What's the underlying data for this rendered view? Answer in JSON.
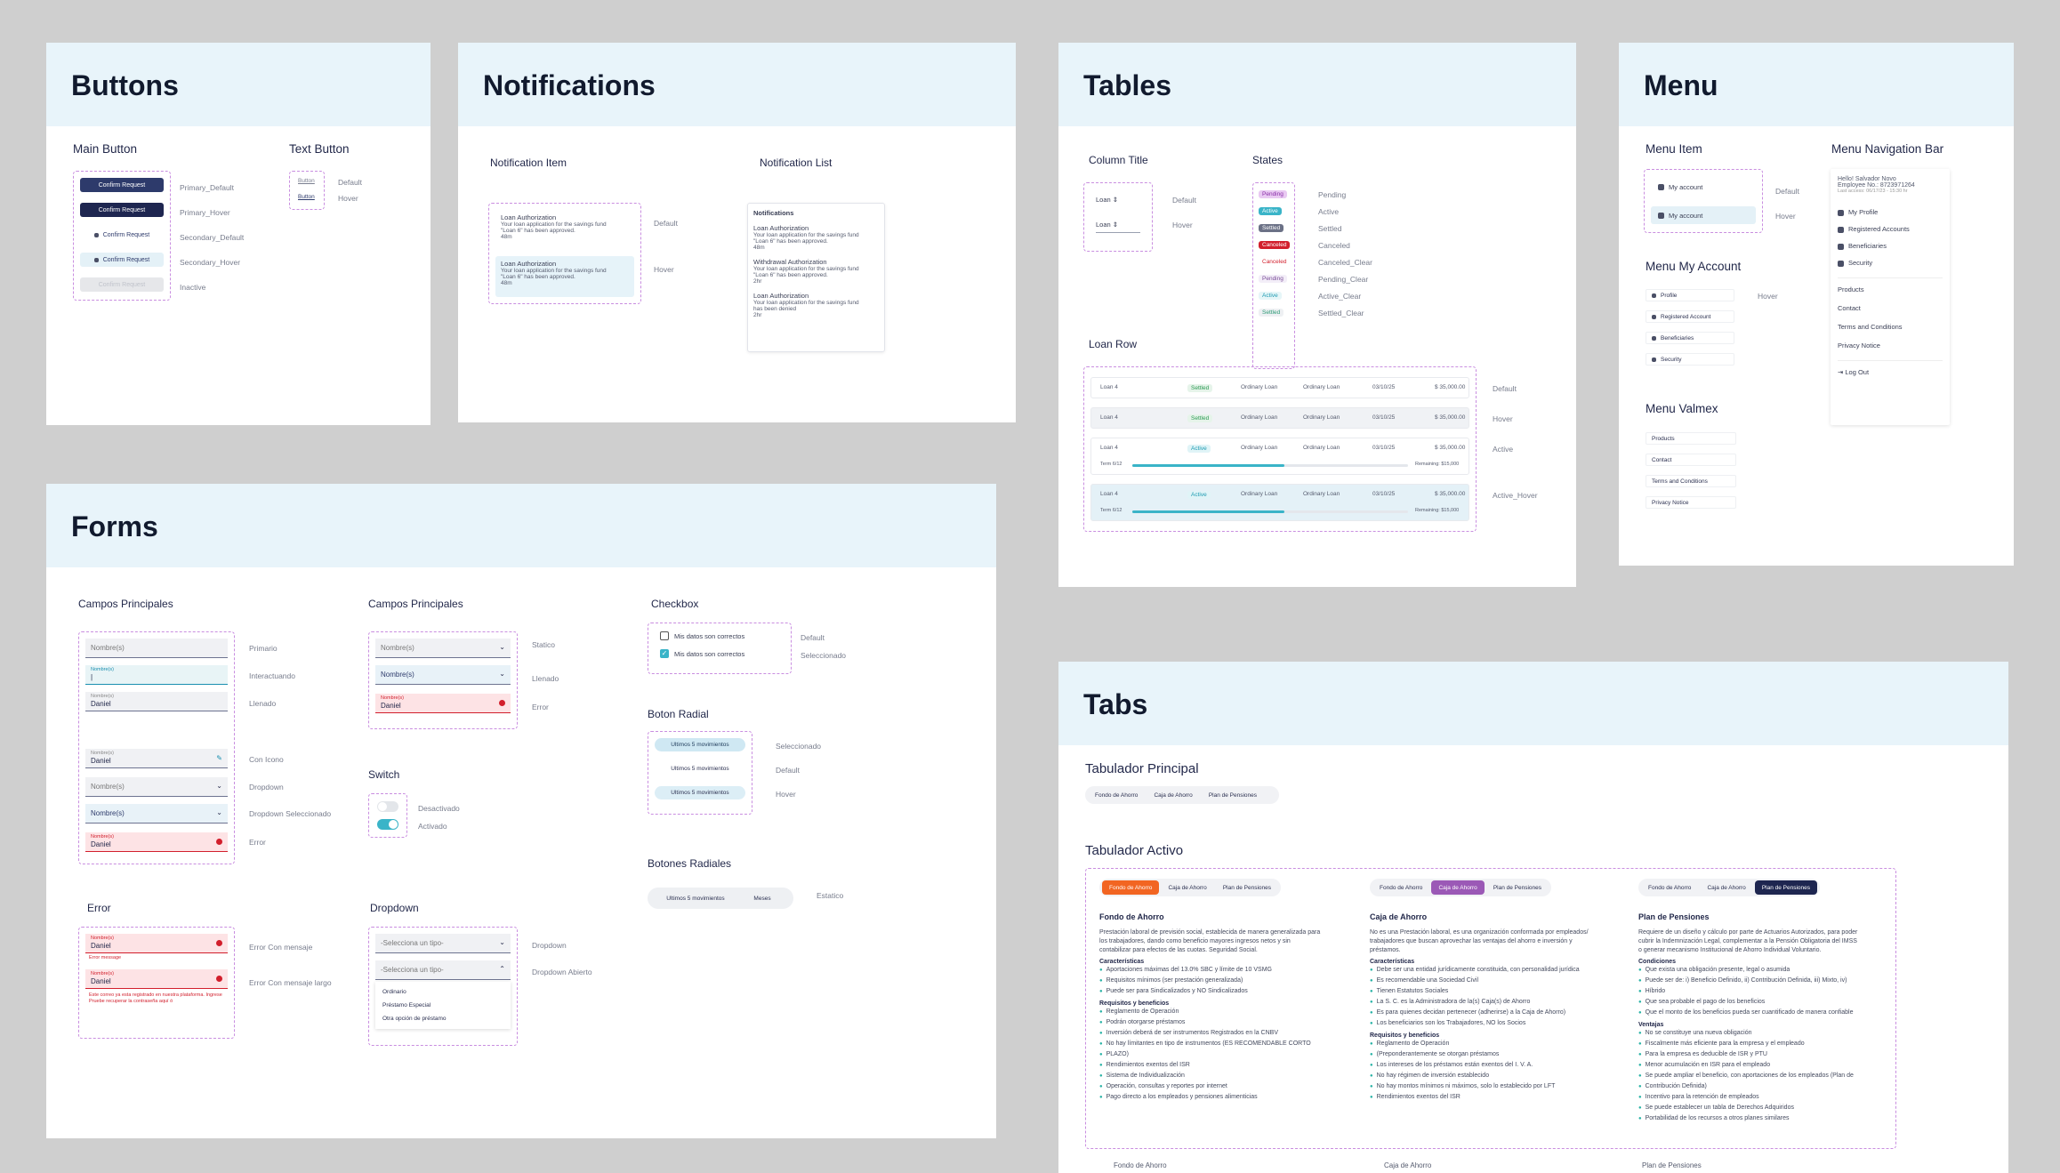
{
  "buttons": {
    "title": "Buttons",
    "main_title": "Main Button",
    "text_title": "Text Button",
    "btn_label": "Confirm Request",
    "states": [
      "Primary_Default",
      "Primary_Hover",
      "Secondary_Default",
      "Secondary_Hover",
      "Inactive"
    ],
    "text_btn": "Button",
    "text_states": [
      "Default",
      "Hover"
    ]
  },
  "notifications": {
    "title": "Notifications",
    "item_title": "Notification Item",
    "list_title": "Notification List",
    "item_head": "Loan Authorization",
    "item_body1": "Your loan application for the savings fund",
    "item_body2": "\"Loan 6\" has been approved.",
    "item_time": "48m",
    "states": [
      "Default",
      "Hover"
    ],
    "list_label": "Notifications",
    "list": [
      {
        "h": "Loan Authorization",
        "b1": "Your loan application for the savings fund",
        "b2": "\"Loan 6\" has been approved.",
        "t": "48m"
      },
      {
        "h": "Withdrawal Authorization",
        "b1": "Your loan application for the savings fund",
        "b2": "\"Loan 6\" has been approved.",
        "t": "2hr"
      },
      {
        "h": "Loan Authorization",
        "b1": "Your loan application for the savings fund",
        "b2": "has been denied",
        "t": "2hr"
      }
    ]
  },
  "tables": {
    "title": "Tables",
    "col_title": "Column Title",
    "states_title": "States",
    "loan_row_title": "Loan Row",
    "col_head": "Loan",
    "col_states": [
      "Default",
      "Hover"
    ],
    "badges": [
      {
        "t": "Pending",
        "l": "Pending"
      },
      {
        "t": "Active",
        "l": "Active"
      },
      {
        "t": "Settled",
        "l": "Settled"
      },
      {
        "t": "Canceled",
        "l": "Canceled"
      },
      {
        "t": "Canceled",
        "l": "Canceled_Clear"
      },
      {
        "t": "Pending",
        "l": "Pending_Clear"
      },
      {
        "t": "Active",
        "l": "Active_Clear"
      },
      {
        "t": "Settled",
        "l": "Settled_Clear"
      }
    ],
    "rows": [
      {
        "n": "Loan 4",
        "s": "Settled",
        "c1": "Ordinary Loan",
        "c2": "Ordinary Loan",
        "d": "03/10/25",
        "a": "$ 35,000.00",
        "st": "Default"
      },
      {
        "n": "Loan 4",
        "s": "Settled",
        "c1": "Ordinary Loan",
        "c2": "Ordinary Loan",
        "d": "03/10/25",
        "a": "$ 35,000.00",
        "st": "Hover"
      },
      {
        "n": "Loan 4",
        "s": "Active",
        "c1": "Ordinary Loan",
        "c2": "Ordinary Loan",
        "d": "03/10/25",
        "a": "$ 35,000.00",
        "st": "Active",
        "term": "Term 6/12",
        "rem": "Remaining: $15,000",
        "p": 0.55
      },
      {
        "n": "Loan 4",
        "s": "Active",
        "c1": "Ordinary Loan",
        "c2": "Ordinary Loan",
        "d": "03/10/25",
        "a": "$ 35,000.00",
        "st": "Active_Hover",
        "term": "Term 6/12",
        "rem": "Remaining: $15,000",
        "p": 0.55
      }
    ]
  },
  "menu": {
    "title": "Menu",
    "item_title": "Menu Item",
    "navbar_title": "Menu Navigation Bar",
    "my_account": "My account",
    "item_states": [
      "Default",
      "Hover"
    ],
    "myacc_title": "Menu My Account",
    "myacc_items": [
      "Profile",
      "Registered Account",
      "Beneficiaries",
      "Security"
    ],
    "myacc_state": "Hover",
    "valmex_title": "Menu Valmex",
    "valmex_items": [
      "Products",
      "Contact",
      "Terms and Conditions",
      "Privacy Notice"
    ],
    "nav": {
      "hello": "Hello! Salvador Novo",
      "emp": "Employee No.: 8723971264",
      "last": "Last access: 06/17/23 - 15:30 hr",
      "items": [
        "My Profile",
        "Registered Accounts",
        "Beneficiaries",
        "Security"
      ],
      "links": [
        "Products",
        "Contact",
        "Terms and Conditions",
        "Privacy Notice"
      ],
      "logout": "Log Out"
    }
  },
  "forms": {
    "title": "Forms",
    "cp_title": "Campos Principales",
    "cp2_title": "Campos Principales",
    "cb_title": "Checkbox",
    "radio_title": "Boton Radial",
    "radios_title": "Botones Radiales",
    "switch_title": "Switch",
    "error_title": "Error",
    "dropdown_title": "Dropdown",
    "field_label": "Nombre(s)",
    "field_value": "Daniel",
    "cp_states": [
      "Primario",
      "Interactuando",
      "Llenado",
      "Con Icono",
      "Dropdown",
      "Dropdown Seleccionado",
      "Error"
    ],
    "cp2_states": [
      "Statico",
      "Llenado",
      "Error"
    ],
    "cb_label": "Mis datos son correctos",
    "cb_states": [
      "Default",
      "Seleccionado"
    ],
    "radio_label": "Ultimos 5 movimientos",
    "radio_states": [
      "Seleccionado",
      "Default",
      "Hover"
    ],
    "radios_opts": [
      "Ultimos 5 movimientos",
      "Meses"
    ],
    "radios_state": "Estatico",
    "switch_states": [
      "Desactivado",
      "Activado"
    ],
    "err_msg": "Error message",
    "err_long": "Este correo ya esta registrado en nuestra plataforma. Ingrese Pruebe recuperar la contraseña aquí ó",
    "err_states": [
      "Error Con mensaje",
      "Error Con mensaje largo"
    ],
    "dd_placeholder": "-Selecciona un tipo-",
    "dd_opts": [
      "Ordinario",
      "Préstamo Especial",
      "Otra opción de préstamo"
    ],
    "dd_states": [
      "Dropdown",
      "Dropdown Abierto"
    ]
  },
  "tabs": {
    "title": "Tabs",
    "principal_title": "Tabulador Principal",
    "activo_title": "Tabulador Activo",
    "names": [
      "Fondo de Ahorro",
      "Caja de Ahorro",
      "Plan de Pensiones"
    ],
    "bottom": [
      "Fondo de Ahorro",
      "Caja de Ahorro",
      "Plan de Pensiones"
    ],
    "panels": [
      {
        "h": "Fondo de Ahorro",
        "p": [
          "Prestación laboral de previsión social, establecida de manera generalizada para",
          "los trabajadores, dando como beneficio mayores ingresos netos y sin",
          "contabilizar para efectos de las cuotas. Seguridad Social."
        ],
        "s1": "Características",
        "b1": [
          "Aportaciones máximas del 13.0% SBC y límite de 10 VSMG",
          "Requisitos mínimos (ser prestación generalizada)",
          "Puede ser para Sindicalizados y NO Sindicalizados"
        ],
        "s2": "Requisitos y beneficios",
        "b2": [
          "Reglamento de Operación",
          "Podrán otorgarse préstamos",
          "Inversión deberá de ser instrumentos Registrados en la CNBV",
          "No hay límitantes en tipo de instrumentos (ES RECOMENDABLE CORTO",
          "PLAZO)",
          "Rendimientos exentos del ISR",
          "Sistema de Individualización",
          "Operación, consultas y reportes por internet",
          "Pago directo a los empleados y pensiones alimenticias"
        ]
      },
      {
        "h": "Caja de Ahorro",
        "p": [
          "No es una Prestación laboral, es una organización conformada por empleados/",
          "trabajadores que buscan aprovechar las ventajas del ahorro e inversión y",
          "préstamos."
        ],
        "s1": "Características",
        "b1": [
          "Debe ser una entidad jurídicamente constituida, con personalidad jurídica",
          "Es recomendable una Sociedad Civil",
          "Tienen Estatutos Sociales",
          "La S. C. es la Administradora de la(s) Caja(s) de Ahorro",
          "Es para quienes decidan pertenecer (adherirse) a la Caja de Ahorro)",
          "Los beneficiarios son los Trabajadores, NO los Socios"
        ],
        "s2": "Requisitos y beneficios",
        "b2": [
          "Reglamento de Operación",
          "(Preponderantemente se otorgan préstamos",
          "Los intereses de los préstamos están exentos del I. V. A.",
          "No hay régimen de inversión establecido",
          "No hay montos mínimos ni máximos, solo lo establecido por LFT",
          "Rendimientos exentos del ISR"
        ]
      },
      {
        "h": "Plan de Pensiones",
        "p": [
          "Requiere de un diseño y cálculo por parte de Actuarios Autorizados, para poder",
          "cubrir la Indemnización Legal, complementar a la Pensión Obligatoria del IMSS",
          "o generar mecanismo Institucional de Ahorro Individual Voluntario."
        ],
        "s1": "Condiciones",
        "b1": [
          "Que exista una obligación presente, legal o asumida",
          "Puede ser de:  i) Beneficio Definido, ii) Contribución Definida, iii) Mixto, iv)",
          "Híbrido",
          "Que sea probable el pago de los beneficios",
          "Que el monto de los beneficios pueda ser cuantificado de manera confiable"
        ],
        "s2": "Ventajas",
        "b2": [
          "No se constituye una nueva obligación",
          "Fiscalmente más eficiente para la empresa y el empleado",
          "Para la empresa es deducible de ISR y PTU",
          "Menor acumulación en ISR para el empleado",
          "Se puede ampliar el beneficio, con aportaciones de los empleados (Plan de",
          "Contribución Definida)",
          "Incentivo para la retención de empleados",
          "Se puede establecer un tabla de Derechos Adquiridos",
          "Portabilidad de los recursos a otros planes similares"
        ]
      }
    ]
  }
}
